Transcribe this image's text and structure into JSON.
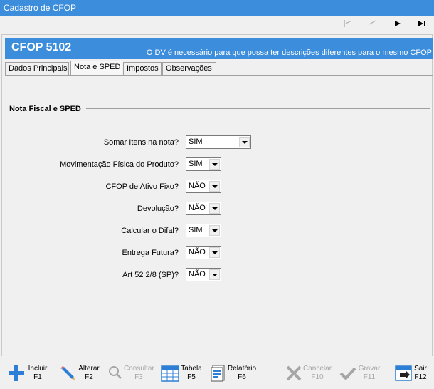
{
  "window": {
    "title": "Cadastro de CFOP"
  },
  "header": {
    "title": "CFOP 5102",
    "note": "O DV é necessário para que possa ter descrições diferentes para o mesmo CFOP"
  },
  "tabs": [
    {
      "label": "Dados Principais"
    },
    {
      "label": "Nota e SPED"
    },
    {
      "label": "Impostos"
    },
    {
      "label": "Observações"
    }
  ],
  "section": {
    "title": "Nota Fiscal e SPED"
  },
  "fields": [
    {
      "label": "Somar Itens na nota?",
      "value": "SIM"
    },
    {
      "label": "Movimentação Física do Produto?",
      "value": "SIM"
    },
    {
      "label": "CFOP de Ativo Fixo?",
      "value": "NÃO"
    },
    {
      "label": "Devolução?",
      "value": "NÃO"
    },
    {
      "label": "Calcular o Difal?",
      "value": "SIM"
    },
    {
      "label": "Entrega Futura?",
      "value": "NÃO"
    },
    {
      "label": "Art 52 2/8 (SP)?",
      "value": "NÃO"
    }
  ],
  "toolbar": {
    "incluir": {
      "label": "Incluir",
      "key": "F1",
      "icon": "plus-icon"
    },
    "alterar": {
      "label": "Alterar",
      "key": "F2",
      "icon": "pencil-icon"
    },
    "consultar": {
      "label": "Consultar",
      "key": "F3",
      "icon": "magnifier-icon"
    },
    "tabela": {
      "label": "Tabela",
      "key": "F5",
      "icon": "table-icon"
    },
    "relatorio": {
      "label": "Relatório",
      "key": "F6",
      "icon": "report-icon"
    },
    "cancelar": {
      "label": "Cancelar",
      "key": "F10",
      "icon": "x-icon"
    },
    "gravar": {
      "label": "Gravar",
      "key": "F11",
      "icon": "check-icon"
    },
    "sair": {
      "label": "Sair",
      "key": "F12",
      "icon": "exit-icon"
    }
  },
  "colors": {
    "accent": "#3c8ddb",
    "background": "#f0f0f0",
    "disabled_text": "#a6a6a6"
  }
}
